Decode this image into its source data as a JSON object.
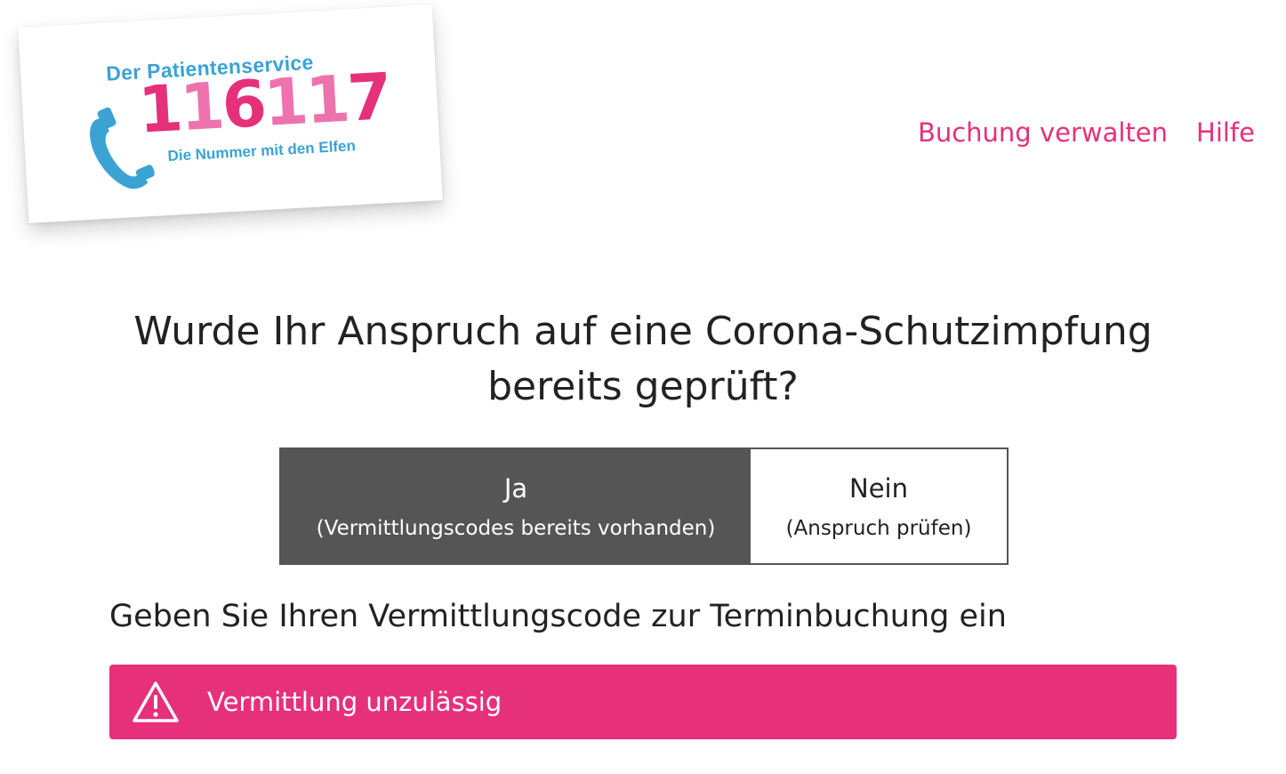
{
  "logo": {
    "subtitle": "Der Patientenservice",
    "number_digits": [
      "1",
      "1",
      "6",
      "1",
      "1",
      "7"
    ],
    "tagline": "Die Nummer mit den Elfen",
    "icon": "phone-icon",
    "colors": {
      "blue": "#3aa3d4",
      "pink_light": "#ee72ae",
      "pink_dark": "#e6307a"
    }
  },
  "nav": {
    "manage_booking": "Buchung verwalten",
    "help": "Hilfe"
  },
  "question": {
    "line1": "Wurde Ihr Anspruch auf eine Corona-Schutzimpfung",
    "line2": "bereits geprüft?"
  },
  "toggle": {
    "selected": "yes",
    "yes": {
      "title": "Ja",
      "subtitle": "(Vermittlungscodes bereits vorhanden)"
    },
    "no": {
      "title": "Nein",
      "subtitle": "(Anspruch prüfen)"
    }
  },
  "prompt": "Geben Sie Ihren Vermittlungscode zur Terminbuchung ein",
  "alert": {
    "icon": "warning-icon",
    "message": "Vermittlung unzulässig",
    "color": "#e6307a"
  },
  "colors": {
    "accent": "#e6307a",
    "toggle_selected": "#555555",
    "text": "#222222"
  }
}
